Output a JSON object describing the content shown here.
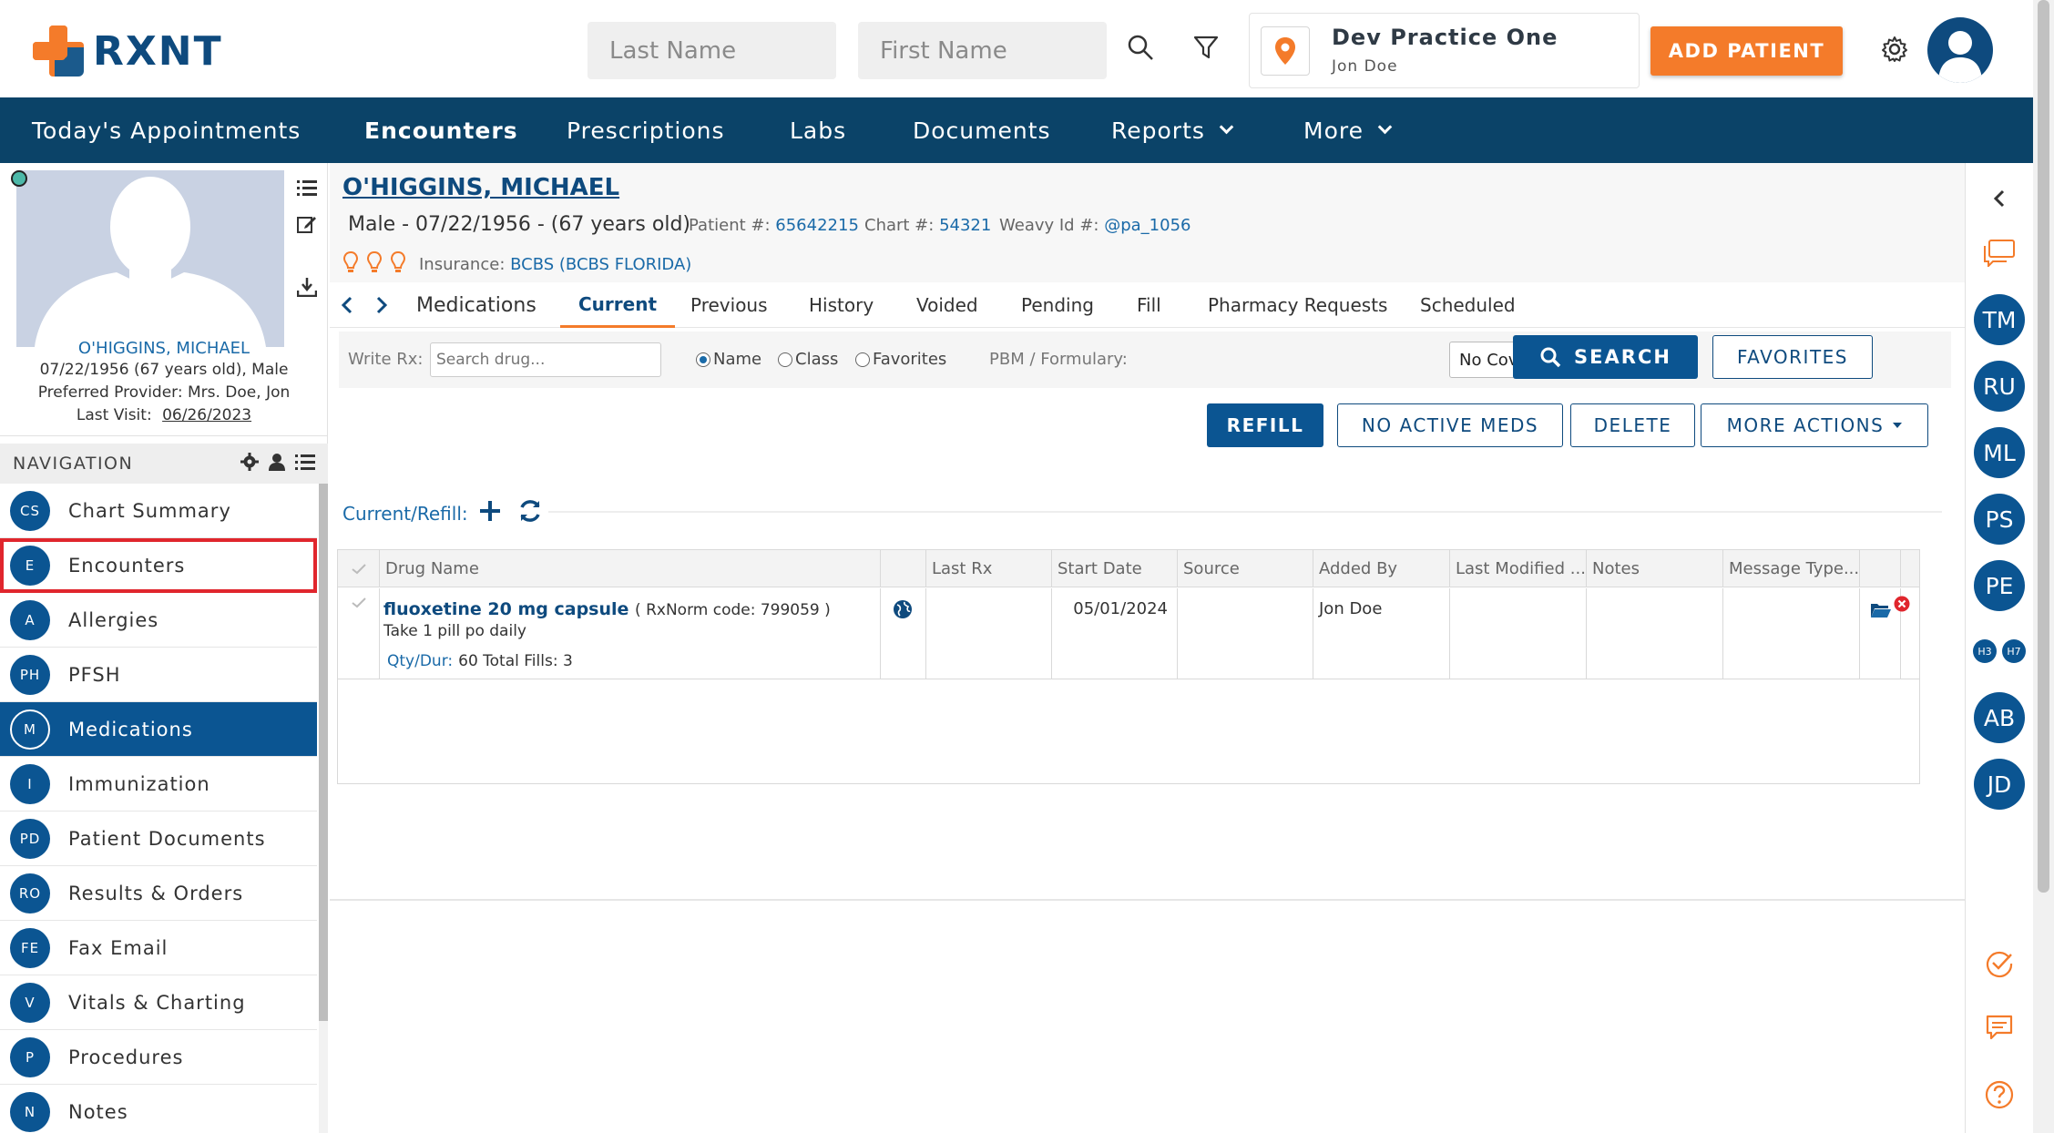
{
  "app": {
    "logo_text": "RXNT"
  },
  "header": {
    "last_name_placeholder": "Last Name",
    "first_name_placeholder": "First Name",
    "practice_name": "Dev Practice One",
    "practice_user": "Jon Doe",
    "add_patient_label": "ADD PATIENT"
  },
  "mainnav": {
    "items": [
      {
        "label": "Today's Appointments"
      },
      {
        "label": "Encounters"
      },
      {
        "label": "Prescriptions"
      },
      {
        "label": "Labs"
      },
      {
        "label": "Documents"
      },
      {
        "label": "Reports"
      },
      {
        "label": "More"
      }
    ],
    "active": "Encounters"
  },
  "profile": {
    "name": "O'HIGGINS, MICHAEL",
    "dob_line": "07/22/1956 (67 years old), Male",
    "provider_line": "Preferred Provider: Mrs. Doe, Jon",
    "last_visit_label": "Last Visit:",
    "last_visit": "06/26/2023"
  },
  "navigation": {
    "title": "NAVIGATION",
    "items": [
      {
        "badge": "CS",
        "label": "Chart Summary"
      },
      {
        "badge": "E",
        "label": "Encounters"
      },
      {
        "badge": "A",
        "label": "Allergies"
      },
      {
        "badge": "PH",
        "label": "PFSH"
      },
      {
        "badge": "M",
        "label": "Medications"
      },
      {
        "badge": "I",
        "label": "Immunization"
      },
      {
        "badge": "PD",
        "label": "Patient Documents"
      },
      {
        "badge": "RO",
        "label": "Results & Orders"
      },
      {
        "badge": "FE",
        "label": "Fax Email"
      },
      {
        "badge": "V",
        "label": "Vitals & Charting"
      },
      {
        "badge": "P",
        "label": "Procedures"
      },
      {
        "badge": "N",
        "label": "Notes"
      }
    ],
    "active": "Medications",
    "highlighted": "Encounters"
  },
  "patient": {
    "name": "O'HIGGINS, MICHAEL",
    "demographics": "Male - 07/22/1956 - (67 years old)",
    "patient_no_label": "Patient #:",
    "patient_no": "65642215",
    "chart_no_label": "Chart #:",
    "chart_no": "54321",
    "weavy_label": "Weavy Id #:",
    "weavy_id": "@pa_1056",
    "insurance_label": "Insurance:",
    "insurance": "BCBS (BCBS FLORIDA)"
  },
  "meds": {
    "section_title": "Medications",
    "tabs": [
      "Current",
      "Previous",
      "History",
      "Voided",
      "Pending",
      "Fill",
      "Pharmacy Requests",
      "Scheduled"
    ],
    "active_tab": "Current",
    "write_rx_label": "Write Rx:",
    "drug_placeholder": "Search drug...",
    "radio_name": "Name",
    "radio_class": "Class",
    "radio_favorites": "Favorites",
    "pbm_label": "PBM / Formulary:",
    "pbm_value": "No Coverage",
    "search_label": "SEARCH",
    "favorites_label": "FAVORITES",
    "refill_label": "REFILL",
    "no_active_label": "NO ACTIVE MEDS",
    "delete_label": "DELETE",
    "more_actions_label": "MORE ACTIONS",
    "current_refill_label": "Current/Refill:"
  },
  "grid": {
    "columns": [
      "Drug Name",
      "Last Rx",
      "Start Date",
      "Source",
      "Added By",
      "Last Modified ...",
      "Notes",
      "Message Type..."
    ],
    "rows": [
      {
        "drug": "fluoxetine 20 mg capsule",
        "rxnorm": "( RxNorm code: 799059 )",
        "sig": "Take 1 pill po daily",
        "qty_label": "Qty/Dur:",
        "qty_value": "60 Total Fills: 3",
        "last_rx": "",
        "start_date": "05/01/2024",
        "source": "",
        "added_by": "Jon Doe",
        "last_modified": "",
        "notes": "",
        "message_type": ""
      }
    ]
  },
  "rightrail": {
    "avatars": [
      "TM",
      "RU",
      "ML",
      "PS",
      "PE",
      "AB",
      "JD"
    ],
    "small_avatars": [
      "H3",
      "H7"
    ]
  },
  "colors": {
    "brand_orange": "#f47b2a",
    "brand_navy": "#0b4368",
    "primary_blue": "#0b5592",
    "highlight_red": "#e0262d"
  }
}
